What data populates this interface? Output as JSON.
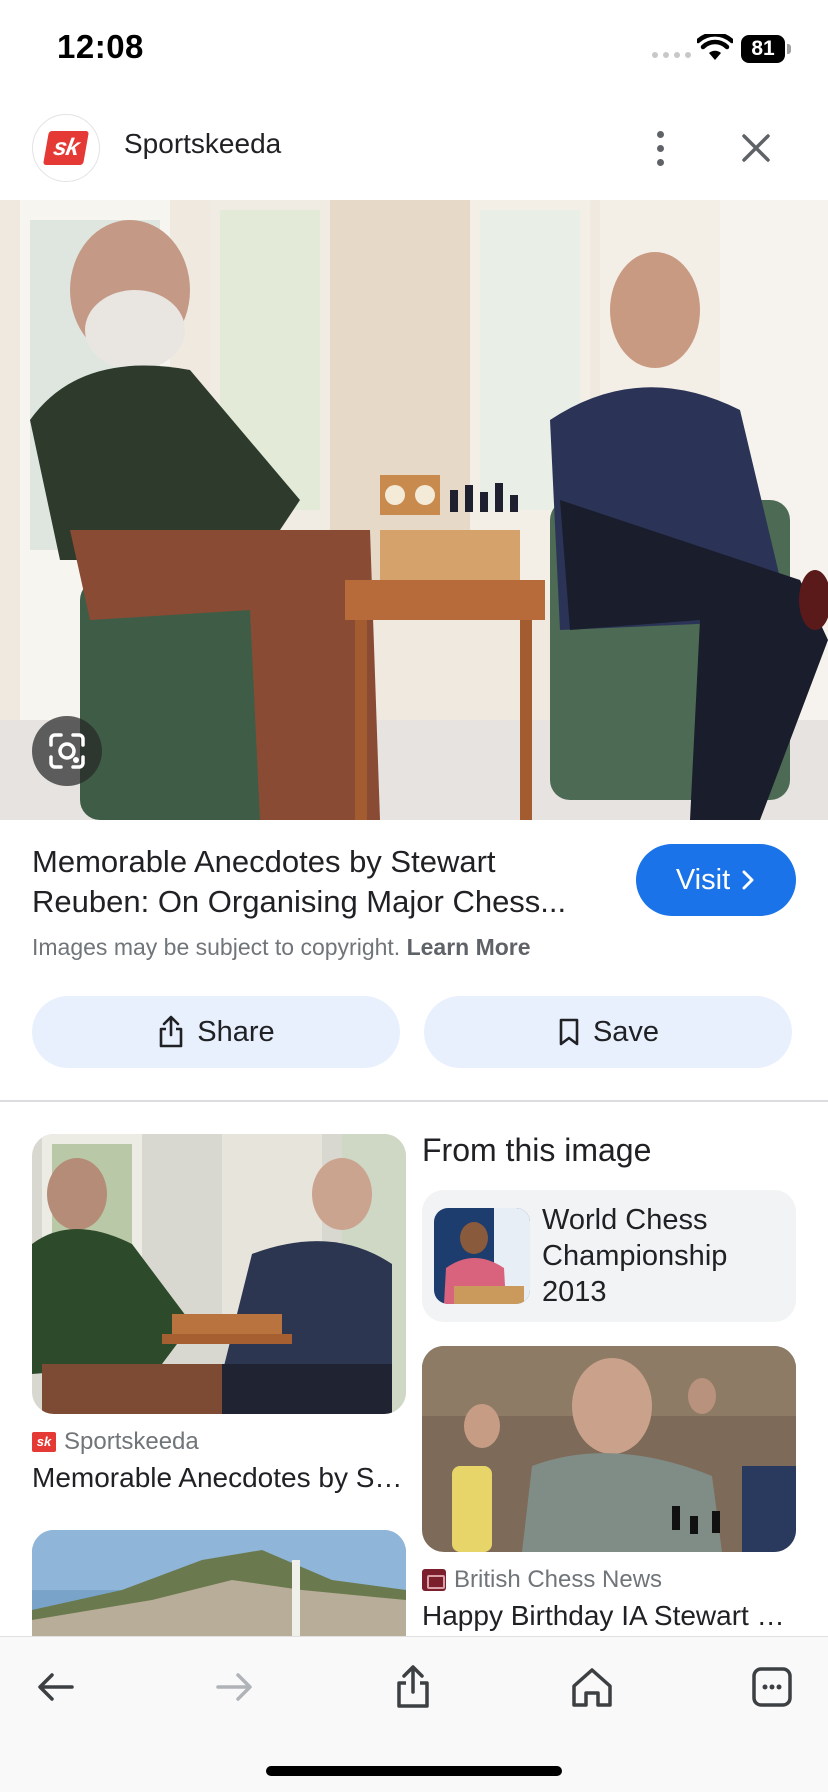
{
  "status_bar": {
    "time": "12:08",
    "battery": "81"
  },
  "header": {
    "logo_text": "sk",
    "site_name": "Sportskeeda",
    "icons": {
      "menu": "more-vert-icon",
      "close": "close-icon"
    }
  },
  "hero": {
    "lens_icon": "google-lens-icon"
  },
  "result": {
    "title": "Memorable Anecdotes by Stewart Reuben: On Organising Major Chess...",
    "visit_label": "Visit",
    "copyright_text": "Images may be subject to copyright.",
    "learn_more": "Learn More",
    "share_label": "Share",
    "save_label": "Save"
  },
  "related": {
    "from_this_image": "From this image",
    "entity_label": "World Chess Championship 2013",
    "cards": [
      {
        "source": "Sportskeeda",
        "caption": "Memorable Anecdotes by Stewart Reuben"
      },
      {
        "source": "British Chess News",
        "caption": "Happy Birthday IA Stewart Reuben"
      }
    ]
  },
  "toolbar": {
    "icons": [
      "back-icon",
      "forward-icon",
      "share-icon",
      "home-icon",
      "tabs-icon"
    ]
  },
  "colors": {
    "accent": "#1a73e8",
    "chip_bg": "#e8f0fe",
    "brand_red": "#e53935"
  }
}
